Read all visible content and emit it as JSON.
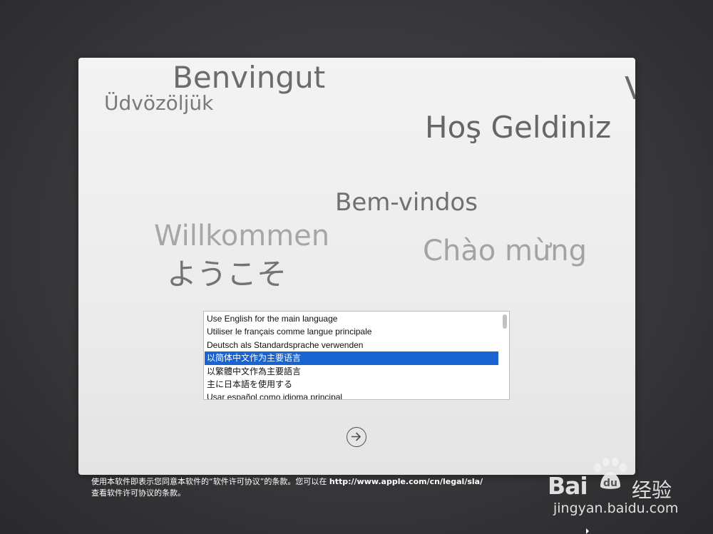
{
  "greetings": {
    "benvingut": "Benvingut",
    "udvozoljuk": "Üdvözöljük",
    "hos_geldiniz": "Hoş Geldiniz",
    "bem_vindos": "Bem-vindos",
    "willkommen": "Willkommen",
    "chao_mung": "Chào mừng",
    "yokoso": "ようこそ",
    "partial_edge": "V"
  },
  "language_list": {
    "items": [
      "Use English for the main language",
      "Utiliser le français comme langue principale",
      "Deutsch als Standardsprache verwenden",
      "以简体中文作为主要语言",
      "以繁體中文作為主要語言",
      "主に日本語を使用する",
      "Usar español como idioma principal"
    ],
    "selected_index": 3
  },
  "next_button": {
    "icon": "arrow-right-circle-icon"
  },
  "footer": {
    "line1_prefix": "使用本软件即表示您同意本软件的“软件许可协议”的条款。您可以在 ",
    "url": "http://www.apple.com/cn/legal/sla/",
    "line2": "查看软件许可协议的条款。"
  },
  "watermark": {
    "logo_text": "Bai",
    "logo_suffix": "经验",
    "domain": "jingyan.baidu.com"
  },
  "colors": {
    "background": "#38383b",
    "panel": "#ececec",
    "selection": "#1a64d1"
  }
}
